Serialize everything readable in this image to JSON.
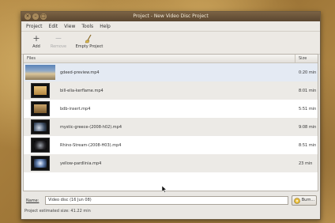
{
  "window": {
    "title": "Project - New Video Disc Project",
    "close_glyph": "×",
    "min_glyph": "–",
    "max_glyph": "□"
  },
  "menu": [
    "Project",
    "Edit",
    "View",
    "Tools",
    "Help"
  ],
  "toolbar": {
    "add_label": "Add",
    "remove_label": "Remove",
    "empty_label": "Empty Project"
  },
  "columns": {
    "name": "Files",
    "size": "Size"
  },
  "files": [
    {
      "name": "gdeed-preview.mp4",
      "size": "0:20 min",
      "thumb": "landscape"
    },
    {
      "name": "bill-elia-kerflame.mp4",
      "size": "8:01 min",
      "thumb": "sunset"
    },
    {
      "name": "bdb-insert.mp4",
      "size": "5:51 min",
      "thumb": "amber"
    },
    {
      "name": "mystic-greece-(2008-h02).mp4",
      "size": "9:08 min",
      "thumb": "night"
    },
    {
      "name": "Rhino-Stream-(2008-H03).mp4",
      "size": "8:51 min",
      "thumb": "dark"
    },
    {
      "name": "yellow-pardlinia.mp4",
      "size": "23 min",
      "thumb": "blue"
    }
  ],
  "bottom": {
    "name_label": "Name:",
    "name_value": "Video disc (16 Jun 08)",
    "burn_label": "Burn..."
  },
  "status_text": "Project estimated size: 41.22 min"
}
